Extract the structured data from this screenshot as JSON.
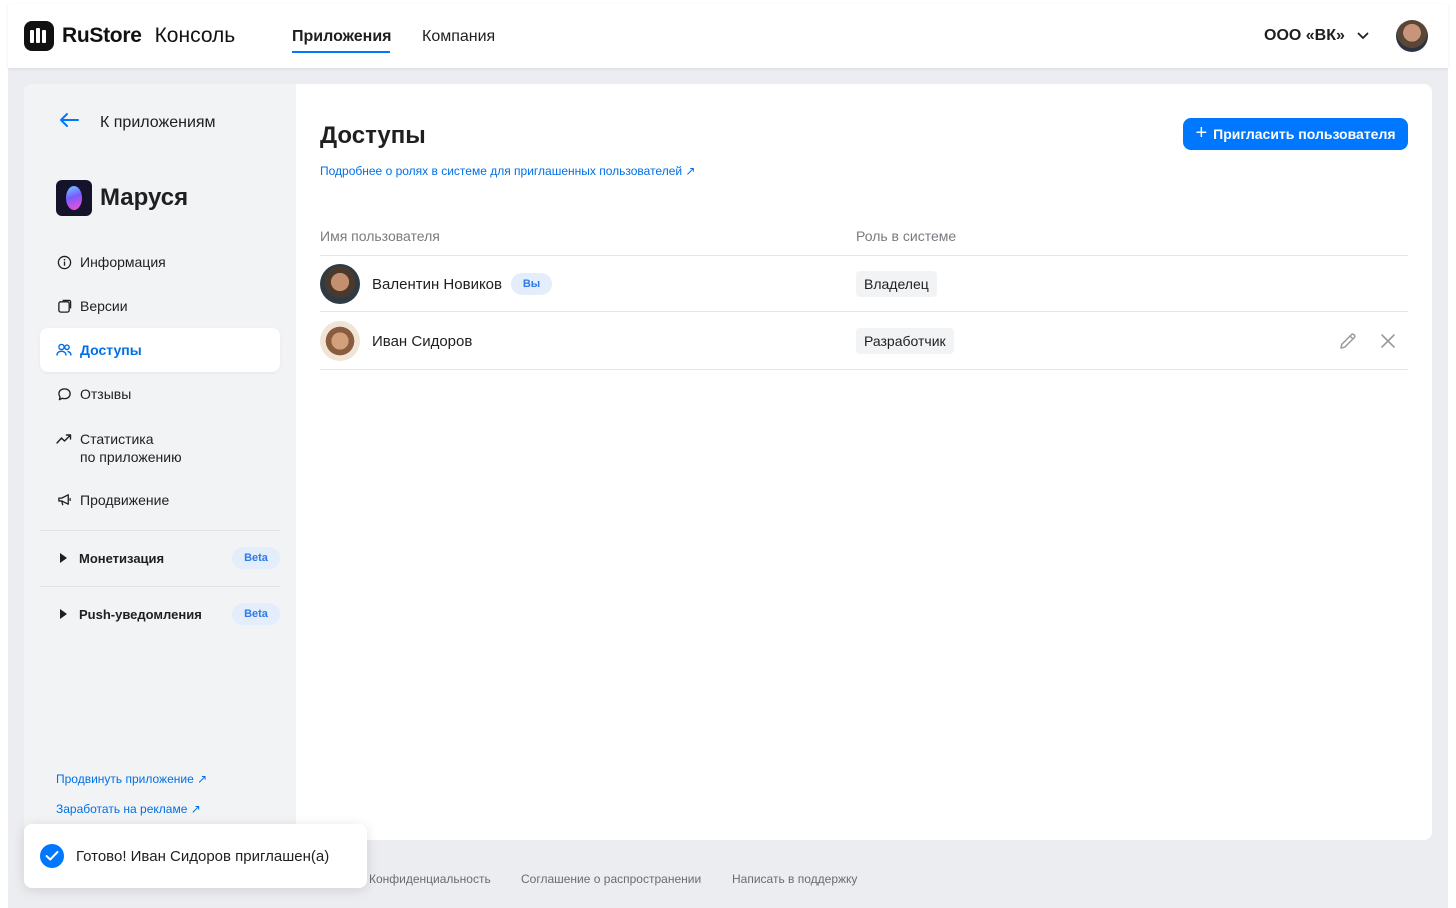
{
  "header": {
    "brand": "RuStore",
    "brand_sub": "Консоль",
    "tabs": [
      {
        "label": "Приложения",
        "active": true
      },
      {
        "label": "Компания",
        "active": false
      }
    ],
    "org": "ООО «ВК»",
    "accent": "#0077ff"
  },
  "sidebar": {
    "back_label": "К приложениям",
    "app_name": "Маруся",
    "items": [
      {
        "label": "Информация",
        "icon": "info-icon"
      },
      {
        "label": "Версии",
        "icon": "versions-icon"
      },
      {
        "label": "Доступы",
        "icon": "users-icon",
        "active": true
      },
      {
        "label": "Отзывы",
        "icon": "chat-bubble-icon"
      },
      {
        "label_line1": "Статистика",
        "label_line2": "по приложению",
        "icon": "chart-icon"
      },
      {
        "label": "Продвижение",
        "icon": "megaphone-icon"
      }
    ],
    "expanders": [
      {
        "label": "Монетизация",
        "badge": "Beta"
      },
      {
        "label": "Push-уведомления",
        "badge": "Beta"
      }
    ],
    "links": [
      {
        "label": "Продвинуть приложение ↗"
      },
      {
        "label": "Заработать на рекламе ↗"
      }
    ]
  },
  "main": {
    "title": "Доступы",
    "roles_link": "Подробнее о ролях в системе для приглашенных пользователей ↗",
    "invite_button": "Пригласить пользователя",
    "columns": [
      "Имя пользователя",
      "Роль в системе"
    ],
    "rows": [
      {
        "name": "Валентин Новиков",
        "badge": "Вы",
        "role": "Владелец"
      },
      {
        "name": "Иван Сидоров",
        "role": "Разработчик"
      }
    ]
  },
  "footer": {
    "links": [
      "Конфиденциальность",
      "Соглашение о распространении",
      "Написать в поддержку"
    ]
  },
  "toast": {
    "message": "Готово! Иван Сидоров приглашен(а)"
  }
}
